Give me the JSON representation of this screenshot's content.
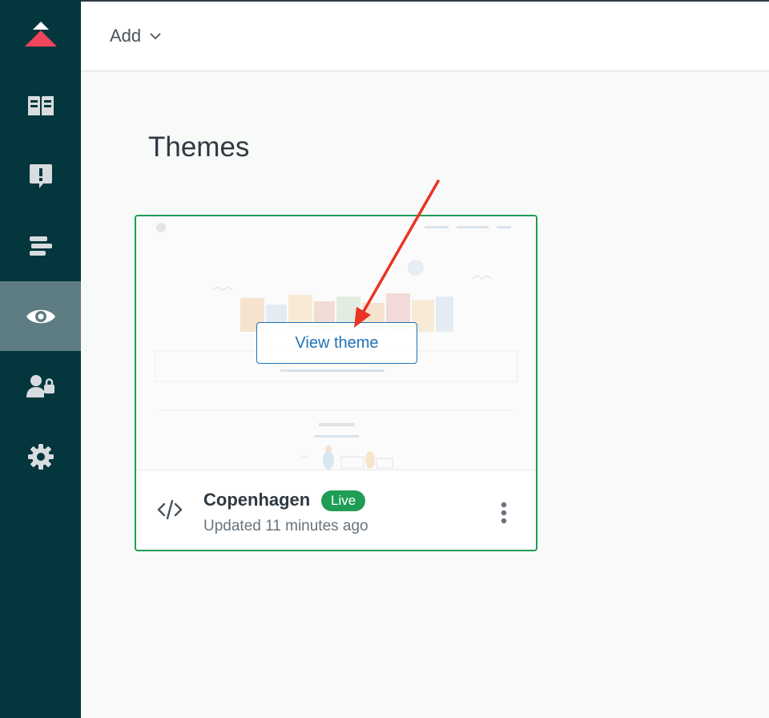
{
  "header": {
    "add_label": "Add"
  },
  "sidebar": {
    "active_index": 3,
    "items": [
      {
        "icon": "guide-book-icon"
      },
      {
        "icon": "alert-message-icon"
      },
      {
        "icon": "arrange-content-icon"
      },
      {
        "icon": "eye-icon"
      },
      {
        "icon": "user-permissions-icon"
      },
      {
        "icon": "gear-icon"
      }
    ]
  },
  "page": {
    "title": "Themes"
  },
  "theme_card": {
    "view_theme_label": "View theme",
    "name": "Copenhagen",
    "status_badge": "Live",
    "updated": "Updated 11 minutes ago"
  },
  "colors": {
    "sidebar_bg": "#03363d",
    "active_item_bg": "#5e7d82",
    "logo_red": "#f0465c",
    "live_green": "#1f9d55",
    "link_blue": "#1f73b7",
    "annotation_arrow": "#eb3223"
  }
}
